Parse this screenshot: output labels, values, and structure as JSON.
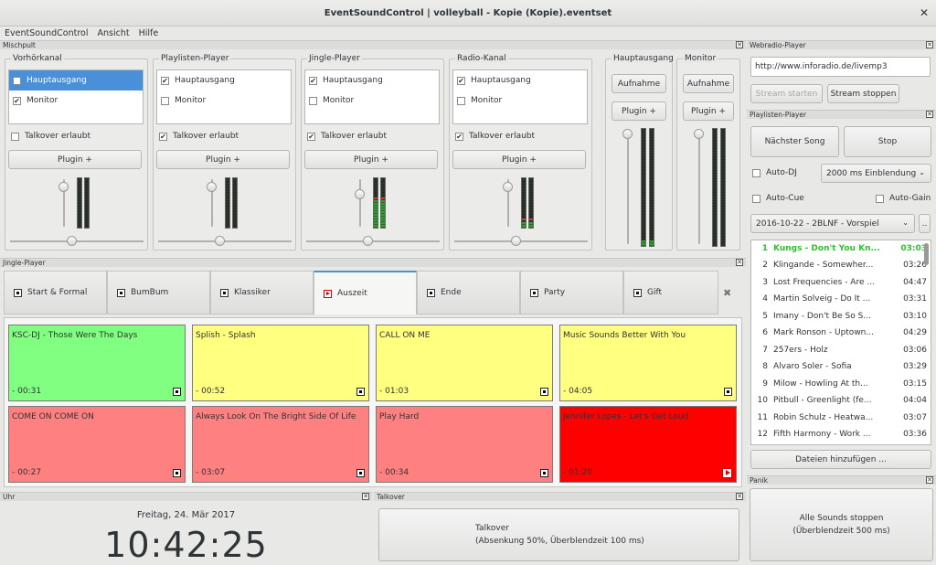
{
  "window": {
    "title": "EventSoundControl | volleyball - Kopie (Kopie).eventset"
  },
  "menu": [
    "EventSoundControl",
    "Ansicht",
    "Hilfe"
  ],
  "mischpult": {
    "title": "Mischpult",
    "channels": [
      {
        "label": "Vorhörkanal",
        "items": [
          {
            "label": "Hauptausgang",
            "checked": false,
            "selected": true
          },
          {
            "label": "Monitor",
            "checked": true,
            "selected": false
          }
        ],
        "talkover": "Talkover erlaubt",
        "talkover_checked": false,
        "plugin": "Plugin +",
        "slider_level": 0.85,
        "meter_level": 0
      },
      {
        "label": "Playlisten-Player",
        "items": [
          {
            "label": "Hauptausgang",
            "checked": true,
            "selected": false
          },
          {
            "label": "Monitor",
            "checked": false,
            "selected": false
          }
        ],
        "talkover": "Talkover erlaubt",
        "talkover_checked": true,
        "plugin": "Plugin +",
        "slider_level": 0.85,
        "meter_level": 0
      },
      {
        "label": "Jingle-Player",
        "items": [
          {
            "label": "Hauptausgang",
            "checked": true,
            "selected": false
          },
          {
            "label": "Monitor",
            "checked": false,
            "selected": false
          }
        ],
        "talkover": "Talkover erlaubt",
        "talkover_checked": true,
        "plugin": "Plugin +",
        "slider_level": 0.7,
        "meter_level": 0.55
      },
      {
        "label": "Radio-Kanal",
        "items": [
          {
            "label": "Hauptausgang",
            "checked": true,
            "selected": false
          },
          {
            "label": "Monitor",
            "checked": false,
            "selected": false
          }
        ],
        "talkover": "Talkover erlaubt",
        "talkover_checked": true,
        "plugin": "Plugin +",
        "slider_level": 0.85,
        "meter_level": 0.12
      }
    ],
    "outputs": [
      {
        "label": "Hauptausgang",
        "record": "Aufnahme",
        "plugin": "Plugin +",
        "meter_level": 0.05
      },
      {
        "label": "Monitor",
        "record": "Aufnahme",
        "plugin": "Plugin +",
        "meter_level": 0
      }
    ]
  },
  "jingle_player": {
    "title": "Jingle-Player",
    "tabs": [
      {
        "label": "Start & Formal",
        "active": false,
        "playing": false
      },
      {
        "label": "BumBum",
        "active": false,
        "playing": false
      },
      {
        "label": "Klassiker",
        "active": false,
        "playing": false
      },
      {
        "label": "Auszeit",
        "active": true,
        "playing": true
      },
      {
        "label": "Ende",
        "active": false,
        "playing": false
      },
      {
        "label": "Party",
        "active": false,
        "playing": false
      },
      {
        "label": "Gift",
        "active": false,
        "playing": false
      }
    ],
    "close_tab": "✖",
    "jingles": [
      {
        "title": "KSC-DJ - Those Were The Days",
        "duration": "- 00:31",
        "color": "#80ff80",
        "playing": false
      },
      {
        "title": "Splish - Splash",
        "duration": "- 00:52",
        "color": "#ffff80",
        "playing": false
      },
      {
        "title": "CALL ON ME",
        "duration": "- 01:03",
        "color": "#ffff80",
        "playing": false
      },
      {
        "title": "Music Sounds Better With You",
        "duration": "- 04:05",
        "color": "#ffff80",
        "playing": false
      },
      {
        "title": "COME ON COME ON",
        "duration": "- 00:27",
        "color": "#ff8080",
        "playing": false
      },
      {
        "title": "Always Look On The Bright Side Of Life",
        "duration": "- 03:07",
        "color": "#ff8080",
        "playing": false
      },
      {
        "title": "Play Hard",
        "duration": "- 00:34",
        "color": "#ff8080",
        "playing": false
      },
      {
        "title": "Jennifer Lopes - Let's Get Loud",
        "duration": "- 01:20",
        "color": "#ff0000",
        "playing": true
      }
    ]
  },
  "uhr": {
    "title": "Uhr",
    "date": "Freitag, 24. Mär 2017",
    "time": "10:42:25"
  },
  "talkover": {
    "title": "Talkover",
    "line1": "Talkover",
    "line2": "(Absenkung 50%, Überblendzeit 100 ms)"
  },
  "webradio": {
    "title": "Webradio-Player",
    "url": "http://www.inforadio.de/livemp3",
    "start": "Stream starten",
    "stop": "Stream stoppen"
  },
  "playlist": {
    "title": "Playlisten-Player",
    "next": "Nächster Song",
    "stop": "Stop",
    "auto_dj": "Auto-DJ",
    "crossfade": "2000 ms Einblendung",
    "auto_cue": "Auto-Cue",
    "auto_gain": "Auto-Gain",
    "list": "2016-10-22 - 2BLNF - Vorspiel",
    "more": "..",
    "add": "Dateien hinzufügen ...",
    "songs": [
      {
        "n": "1",
        "title": "Kungs - Don't You Kn...",
        "dur": "03:03",
        "current": true
      },
      {
        "n": "2",
        "title": "Klingande - Somewher...",
        "dur": "03:26",
        "current": false
      },
      {
        "n": "3",
        "title": "Lost Frequencies - Are ...",
        "dur": "04:47",
        "current": false
      },
      {
        "n": "4",
        "title": "Martin Solveig - Do It ...",
        "dur": "03:31",
        "current": false
      },
      {
        "n": "5",
        "title": "Imany - Don't Be So S...",
        "dur": "03:10",
        "current": false
      },
      {
        "n": "6",
        "title": "Mark Ronson - Uptown...",
        "dur": "04:29",
        "current": false
      },
      {
        "n": "7",
        "title": "257ers - Holz",
        "dur": "03:06",
        "current": false
      },
      {
        "n": "8",
        "title": "Alvaro Soler - Sofia",
        "dur": "03:29",
        "current": false
      },
      {
        "n": "9",
        "title": "Milow - Howling At th...",
        "dur": "03:15",
        "current": false
      },
      {
        "n": "10",
        "title": "Pitbull - Greenlight (fe...",
        "dur": "04:04",
        "current": false
      },
      {
        "n": "11",
        "title": "Robin Schulz - Heatwa...",
        "dur": "03:07",
        "current": false
      },
      {
        "n": "12",
        "title": "Fifth Harmony - Work ...",
        "dur": "03:36",
        "current": false
      }
    ]
  },
  "panik": {
    "title": "Panik",
    "line1": "Alle Sounds stoppen",
    "line2": "(Überblendzeit 500 ms)"
  }
}
